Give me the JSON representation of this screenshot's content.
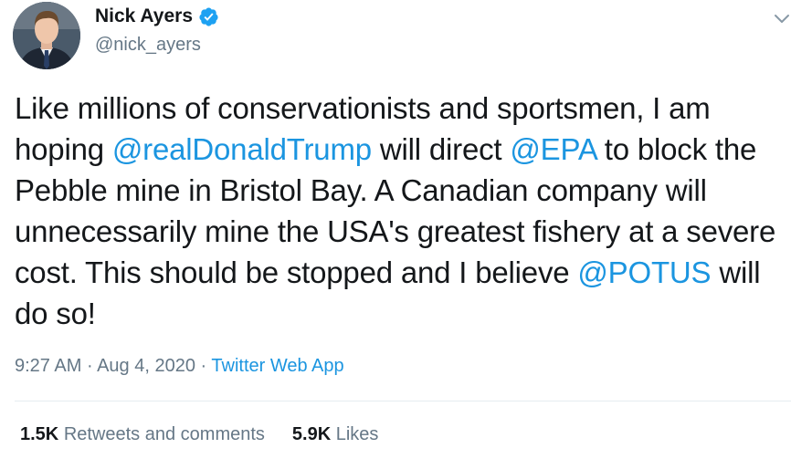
{
  "user": {
    "display_name": "Nick Ayers",
    "handle": "@nick_ayers",
    "verified": true
  },
  "tweet": {
    "segments": [
      {
        "type": "text",
        "value": "Like millions of conservationists and sportsmen, I am hoping "
      },
      {
        "type": "mention",
        "value": "@realDonaldTrump"
      },
      {
        "type": "text",
        "value": " will direct "
      },
      {
        "type": "mention",
        "value": "@EPA"
      },
      {
        "type": "text",
        "value": " to block the Pebble mine in Bristol Bay. A Canadian company will unnecessarily mine the USA's greatest fishery at a severe cost. This should be stopped and I believe "
      },
      {
        "type": "mention",
        "value": "@POTUS"
      },
      {
        "type": "text",
        "value": " will do so!"
      }
    ]
  },
  "meta": {
    "time": "9:27 AM",
    "separator": "·",
    "date": "Aug 4, 2020",
    "source": "Twitter Web App"
  },
  "stats": {
    "retweets_count": "1.5K",
    "retweets_label": "Retweets and comments",
    "likes_count": "5.9K",
    "likes_label": "Likes"
  },
  "colors": {
    "link": "#1b95e0",
    "secondary_text": "#657786",
    "primary_text": "#14171a",
    "verified_badge": "#1da1f2"
  },
  "icons": {
    "verified": "verified-badge-icon",
    "more": "chevron-down-icon"
  }
}
